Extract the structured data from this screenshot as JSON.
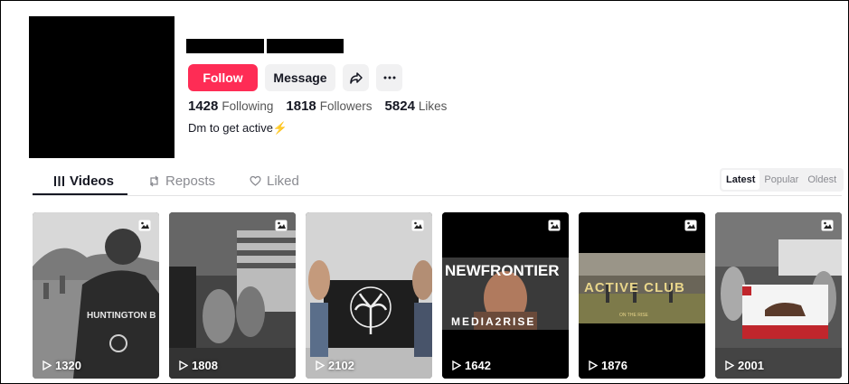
{
  "profile": {
    "follow_label": "Follow",
    "message_label": "Message",
    "share_icon": "share-icon",
    "more_icon": "more-icon",
    "following_count": "1428",
    "following_label": "Following",
    "followers_count": "1818",
    "followers_label": "Followers",
    "likes_count": "5824",
    "likes_label": "Likes",
    "bio": "Dm to get active⚡"
  },
  "tabs": [
    {
      "label": "Videos",
      "icon": "grid-icon",
      "active": true
    },
    {
      "label": "Reposts",
      "icon": "repost-icon",
      "active": false
    },
    {
      "label": "Liked",
      "icon": "heart-icon",
      "active": false
    }
  ],
  "sort": {
    "options": [
      "Latest",
      "Popular",
      "Oldest"
    ],
    "selected": "Latest"
  },
  "videos": [
    {
      "views": "1320",
      "overlay_text": "HUNTINGTON B",
      "icon": "photo-icon"
    },
    {
      "views": "1808",
      "overlay_text": "",
      "icon": "photo-icon"
    },
    {
      "views": "2102",
      "overlay_text": "",
      "icon": "photo-icon"
    },
    {
      "views": "1642",
      "overlay_text": "NEWFRONTIER",
      "overlay_text_2": "MEDIA2RISE",
      "icon": "photo-icon"
    },
    {
      "views": "1876",
      "overlay_text": "ACTIVE CLUB",
      "overlay_text_2": "ON THE RISE",
      "icon": "photo-icon"
    },
    {
      "views": "2001",
      "overlay_text": "",
      "icon": "photo-icon"
    }
  ],
  "colors": {
    "accent": "#fe2c55",
    "button_bg": "#f1f1f2",
    "text": "#161823",
    "muted": "#8a8b91"
  }
}
